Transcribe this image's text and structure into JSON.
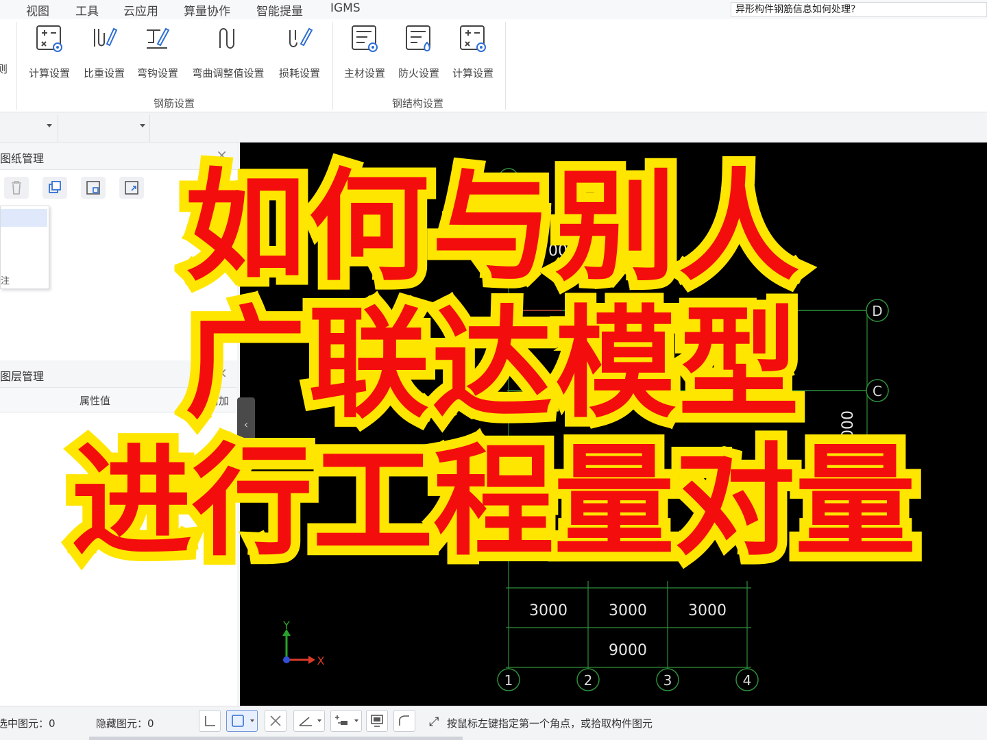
{
  "menubar": {
    "items": [
      "视图",
      "工具",
      "云应用",
      "算量协作",
      "智能提量",
      "IGMS"
    ],
    "search_value": "异形构件钢筋信息如何处理?"
  },
  "ribbon": {
    "clipped_label": "则",
    "groups": [
      {
        "label": "钢筋设置",
        "buttons": [
          {
            "label": "计算设置",
            "icon": "calc-settings-icon"
          },
          {
            "label": "比重设置",
            "icon": "density-settings-icon"
          },
          {
            "label": "弯钩设置",
            "icon": "hook-settings-icon"
          },
          {
            "label": "弯曲调整值设置",
            "icon": "bend-adjust-icon"
          },
          {
            "label": "损耗设置",
            "icon": "loss-settings-icon"
          }
        ]
      },
      {
        "label": "钢结构设置",
        "buttons": [
          {
            "label": "主材设置",
            "icon": "main-material-icon"
          },
          {
            "label": "防火设置",
            "icon": "fireproof-icon"
          },
          {
            "label": "计算设置",
            "icon": "calc-settings-icon"
          }
        ]
      }
    ]
  },
  "panels": {
    "drawing_title": "图纸管理",
    "layer_title": "图层管理",
    "layer_col_value": "属性值",
    "layer_col_add": "附加",
    "dropdown_stub": "注"
  },
  "canvas": {
    "axis_x_label": "X",
    "axis_y_label": "Y",
    "axis_top_label": "1",
    "row_labels": [
      "D",
      "C"
    ],
    "col_labels": [
      "1",
      "2",
      "3",
      "4"
    ],
    "dims": [
      "3000",
      "3000",
      "3000"
    ],
    "total_dim": "9000",
    "right_dim": "000",
    "partial_dim": "00"
  },
  "status": {
    "selected_label": "选中图元：0",
    "hidden_label": "隐藏图元：0",
    "hint": "按鼠标左键指定第一个角点，或拾取构件图元"
  },
  "overlay": {
    "line1": "如何与别人",
    "line2": "广联达模型",
    "line3": "进行工程量对量"
  },
  "colors": {
    "overlay_fill": "#f40d0d",
    "overlay_stroke": "#ffe600",
    "grid_line": "#2f8f3a",
    "canvas_bg": "#000000",
    "icon_blue": "#2f6fd6"
  }
}
